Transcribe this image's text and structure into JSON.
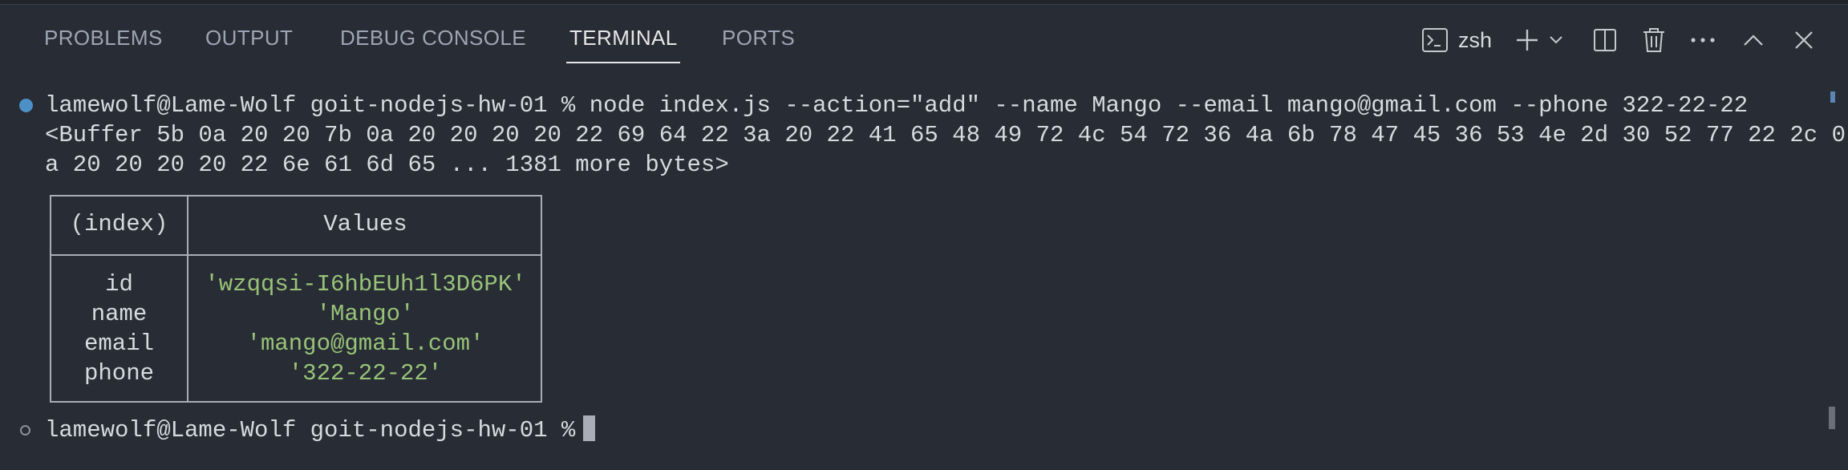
{
  "panel": {
    "tabs": [
      {
        "label": "PROBLEMS"
      },
      {
        "label": "OUTPUT"
      },
      {
        "label": "DEBUG CONSOLE"
      },
      {
        "label": "TERMINAL",
        "active": true
      },
      {
        "label": "PORTS"
      }
    ],
    "toolbar": {
      "shell_name": "zsh",
      "icons": [
        "terminal-icon",
        "plus-icon",
        "chevron-down-icon",
        "split-icon",
        "trash-icon",
        "more-icon",
        "chevron-up-icon",
        "close-icon"
      ]
    },
    "colors": {
      "background": "#282c34",
      "accent_dot": "#4d8fc7",
      "string": "#98c379"
    }
  },
  "terminal": {
    "prompt": "lamewolf@Lame-Wolf goit-nodejs-hw-01 %",
    "command": "node index.js --action=\"add\" --name Mango --email mango@gmail.com --phone 322-22-22",
    "buffer_line_1": "<Buffer 5b 0a 20 20 7b 0a 20 20 20 20 22 69 64 22 3a 20 22 41 65 48 49 72 4c 54 72 36 4a 6b 78 47 45 36 53 4e 2d 30 52 77 22 2c 0",
    "buffer_line_2": "a 20 20 20 20 22 6e 61 6d 65 ... 1381 more bytes>",
    "table": {
      "headers": {
        "index": "(index)",
        "values": "Values"
      },
      "rows": [
        {
          "key": "id",
          "value": "'wzqqsi-I6hbEUh1l3D6PK'"
        },
        {
          "key": "name",
          "value": "'Mango'"
        },
        {
          "key": "email",
          "value": "'mango@gmail.com'"
        },
        {
          "key": "phone",
          "value": "'322-22-22'"
        }
      ]
    },
    "final_prompt": "lamewolf@Lame-Wolf goit-nodejs-hw-01 %"
  }
}
